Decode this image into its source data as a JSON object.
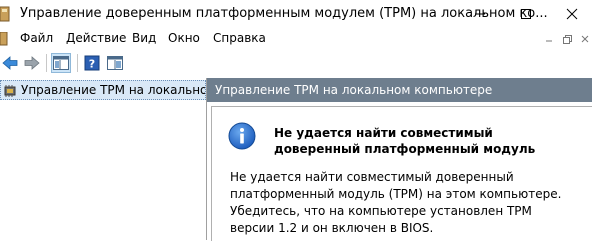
{
  "window": {
    "title": "Управление доверенным платформенным модулем (TPM) на локальном ко...",
    "min_glyph": "—",
    "max_glyph": "☐",
    "close_glyph": "✕"
  },
  "menu": {
    "items": [
      "Файл",
      "Действие",
      "Вид",
      "Окно",
      "Справка"
    ]
  },
  "tree": {
    "selected_label": "Управление TPM на локальном к"
  },
  "content": {
    "header": "Управление TPM на локальном компьютере",
    "message_title": "Не удается найти совместимый доверенный платформенный модуль",
    "message_body": "Не удается найти совместимый доверенный платформенный модуль (TPM) на этом компьютере. Убедитесь, что на компьютере установлен TPM версии 1.2 и он включен в BIOS."
  },
  "icons": {
    "back": "back-arrow-icon",
    "forward": "forward-arrow-icon",
    "console_tree": "console-tree-icon",
    "help": "help-icon",
    "action_pane": "action-pane-icon",
    "info": "info-icon"
  },
  "colors": {
    "pane_header_bg": "#6e7e8e",
    "selection_bg": "#d9e8f7",
    "info_blue": "#1f5fbf"
  }
}
